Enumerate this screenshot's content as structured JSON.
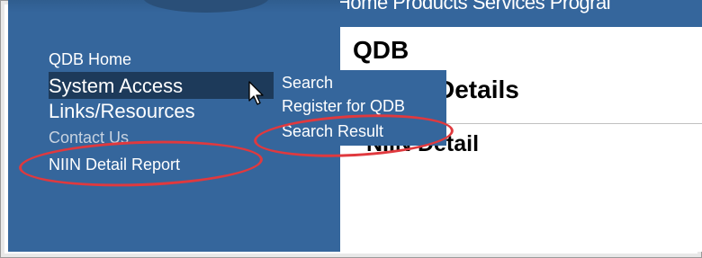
{
  "topnav": {
    "text": "Home  Products  Services  Prograi"
  },
  "sidebar": {
    "items": [
      {
        "label": "QDB Home"
      },
      {
        "label": "System Access"
      },
      {
        "label": "Links/Resources"
      },
      {
        "label": "Contact Us"
      },
      {
        "label": "NIIN Detail Report"
      }
    ]
  },
  "submenu": {
    "items": [
      {
        "label": "Search"
      },
      {
        "label": "Register for QDB"
      },
      {
        "label": "Search Result"
      }
    ]
  },
  "main": {
    "title": "QDB",
    "subtitle": "Details",
    "section_title": "NIIN Detail"
  },
  "colors": {
    "sidebar": "#35669c",
    "highlight": "#1d3a5a",
    "annotation": "#e0393e"
  },
  "icons": {
    "cursor": "mouse-pointer-icon"
  }
}
